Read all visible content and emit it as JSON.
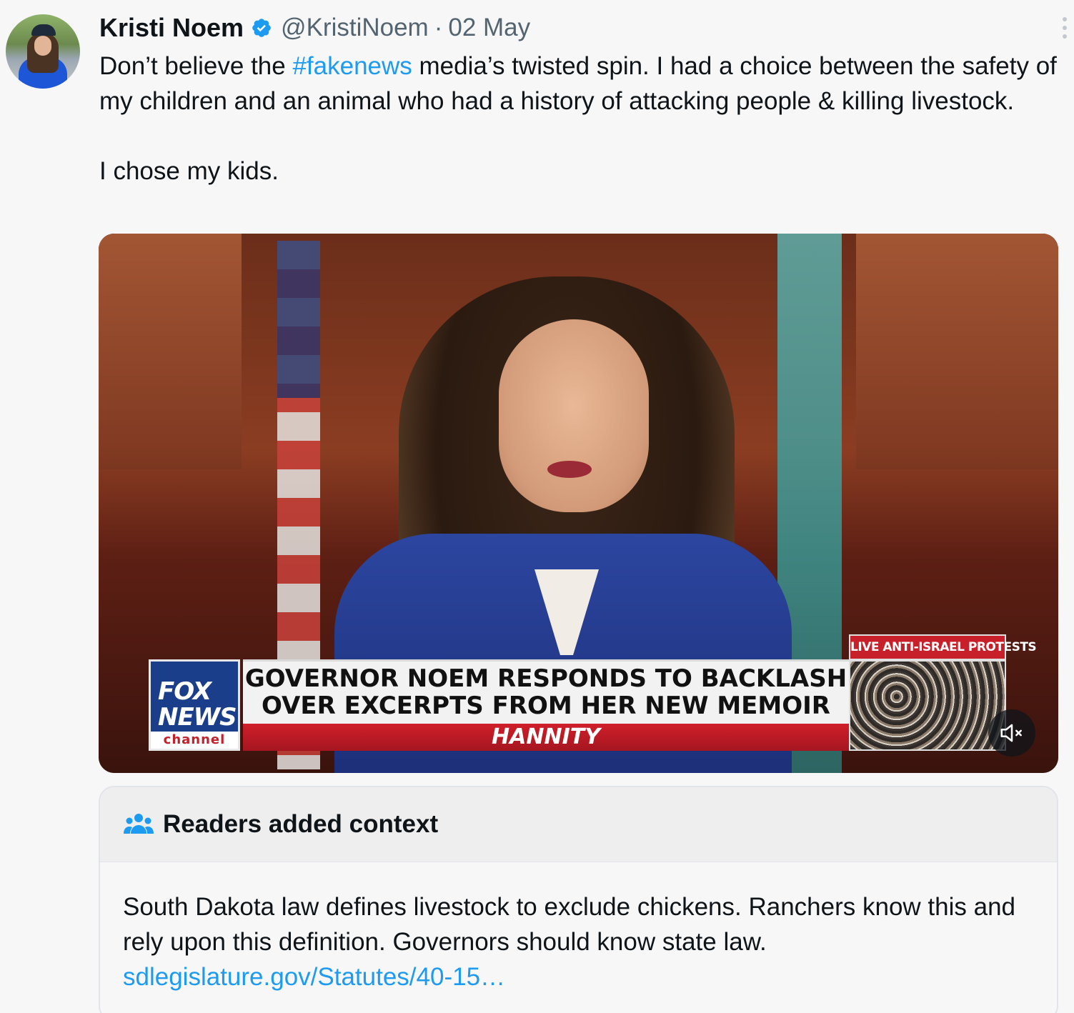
{
  "author": {
    "display_name": "Kristi Noem",
    "handle": "@KristiNoem",
    "separator": "·",
    "date": "02 May",
    "avatar_icon": "profile-photo",
    "verified_icon": "verified-badge-icon"
  },
  "tweet": {
    "text_before_hashtag": "Don’t believe the ",
    "hashtag": "#fakenews",
    "text_after_hashtag": " media’s twisted spin. I had a choice between the safety of my children and an animal who had a history of attacking people & killing livestock.",
    "second_paragraph": "I chose my kids."
  },
  "media": {
    "network_logo_top": "FOX",
    "network_logo_bottom": "NEWS",
    "network_logo_sub": "channel",
    "headline_line1": "GOVERNOR NOEM RESPONDS TO BACKLASH",
    "headline_line2": "OVER EXCERPTS FROM HER NEW MEMOIR",
    "show_name": "HANNITY",
    "inset_label": "LIVE ANTI-ISRAEL PROTESTS",
    "mute_icon": "volume-muted-icon"
  },
  "community_note": {
    "title": "Readers added context",
    "body": "South Dakota law defines livestock to exclude chickens. Ranchers know this and rely upon this definition. Governors should know state law.",
    "link": "sdlegislature.gov/Statutes/40-15…",
    "icon": "people-group-icon"
  },
  "colors": {
    "link": "#1d9bf0",
    "text": "#0f1419",
    "muted": "#536471",
    "background": "#f7f7f7"
  }
}
